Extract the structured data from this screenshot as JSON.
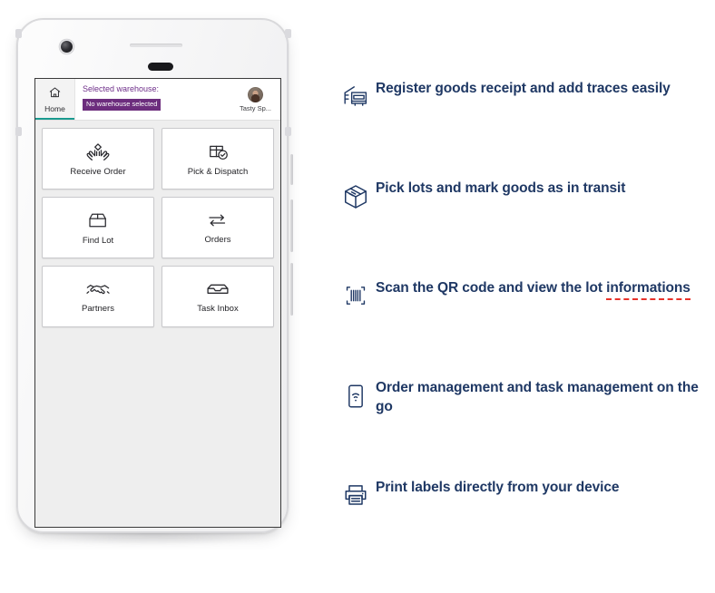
{
  "app": {
    "home_tab": {
      "label": "Home",
      "icon": "home-icon"
    },
    "warehouse": {
      "title": "Selected warehouse:",
      "badge": "No warehouse selected",
      "badge_color": "#6c2d7d",
      "title_color": "#6f2f8a"
    },
    "user": {
      "name": "Tasty Sp...",
      "avatar": "user-avatar"
    },
    "active_tab_accent": "#1a9a8f",
    "tiles": [
      {
        "label": "Receive Order",
        "icon": "hands-package-icon"
      },
      {
        "label": "Pick & Dispatch",
        "icon": "box-check-icon"
      },
      {
        "label": "Find Lot",
        "icon": "open-box-icon"
      },
      {
        "label": "Orders",
        "icon": "two-way-arrows-icon"
      },
      {
        "label": "Partners",
        "icon": "handshake-icon"
      },
      {
        "label": "Task Inbox",
        "icon": "inbox-tray-icon"
      }
    ]
  },
  "features": {
    "text_color": "#1f3864",
    "spellcheck_color": "#e8322a",
    "items": [
      {
        "icon": "loading-dock-truck-icon",
        "text": "Register goods receipt and add traces easily"
      },
      {
        "icon": "package-box-icon",
        "text": "Pick lots and mark goods as in transit"
      },
      {
        "icon": "barcode-scan-icon",
        "text_before": "Scan the QR code and view the lot ",
        "misspelled_word": "informations"
      },
      {
        "icon": "phone-signal-icon",
        "text": "Order management and task management on the go"
      },
      {
        "icon": "printer-icon",
        "text": "Print labels directly from your device"
      }
    ]
  }
}
